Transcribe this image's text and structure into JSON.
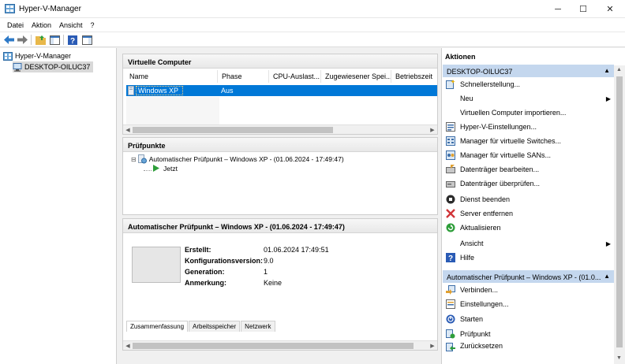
{
  "window": {
    "title": "Hyper-V-Manager",
    "controls": {
      "minimize": "─",
      "maximize": "☐",
      "close": "✕"
    }
  },
  "menu": [
    "Datei",
    "Aktion",
    "Ansicht",
    "?"
  ],
  "tree": {
    "root": "Hyper-V-Manager",
    "host": "DESKTOP-OILUC37"
  },
  "vm_panel": {
    "title": "Virtuelle Computer",
    "columns": [
      "Name",
      "Phase",
      "CPU-Auslast...",
      "Zugewiesener Spei...",
      "Betriebszeit"
    ],
    "rows": [
      {
        "name": "Windows XP",
        "phase": "Aus",
        "cpu": "",
        "mem": "",
        "uptime": ""
      }
    ]
  },
  "checkpoint_panel": {
    "title": "Prüfpunkte",
    "items": [
      "Automatischer Prüfpunkt – Windows XP - (01.06.2024 - 17:49:47)",
      "Jetzt"
    ]
  },
  "details_panel": {
    "title": "Automatischer Prüfpunkt – Windows XP - (01.06.2024 - 17:49:47)",
    "fields": [
      {
        "label": "Erstellt:",
        "value": "01.06.2024 17:49:51"
      },
      {
        "label": "Konfigurationsversion:",
        "value": "9.0"
      },
      {
        "label": "Generation:",
        "value": "1"
      },
      {
        "label": "Anmerkung:",
        "value": "Keine"
      }
    ],
    "tabs": [
      "Zusammenfassung",
      "Arbeitsspeicher",
      "Netzwerk"
    ]
  },
  "actions_panel": {
    "title": "Aktionen",
    "section1": {
      "header": "DESKTOP-OILUC37",
      "items": [
        {
          "label": "Schnellerstellung...",
          "icon": "quick-create-icon"
        },
        {
          "label": "Neu",
          "icon": "",
          "submenu": "▶"
        },
        {
          "label": "Virtuellen Computer importieren...",
          "icon": "import-icon"
        },
        {
          "label": "Hyper-V-Einstellungen...",
          "icon": "settings-icon"
        },
        {
          "label": "Manager für virtuelle Switches...",
          "icon": "switch-icon"
        },
        {
          "label": "Manager für virtuelle SANs...",
          "icon": "san-icon"
        },
        {
          "label": "Datenträger bearbeiten...",
          "icon": "edit-disk-icon"
        },
        {
          "label": "Datenträger überprüfen...",
          "icon": "inspect-disk-icon"
        },
        {
          "label": "Dienst beenden",
          "icon": "stop-service-icon"
        },
        {
          "label": "Server entfernen",
          "icon": "remove-server-icon"
        },
        {
          "label": "Aktualisieren",
          "icon": "refresh-icon"
        },
        {
          "label": "Ansicht",
          "icon": "",
          "submenu": "▶"
        },
        {
          "label": "Hilfe",
          "icon": "help-icon"
        }
      ]
    },
    "section2": {
      "header": "Automatischer Prüfpunkt – Windows XP - (01.0...",
      "items": [
        {
          "label": "Verbinden...",
          "icon": "connect-icon"
        },
        {
          "label": "Einstellungen...",
          "icon": "vm-settings-icon"
        },
        {
          "label": "Starten",
          "icon": "start-icon"
        },
        {
          "label": "Prüfpunkt",
          "icon": "checkpoint-icon"
        },
        {
          "label": "Zurücksetzen",
          "icon": "revert-icon"
        }
      ]
    }
  },
  "colors": {
    "selection": "#0078d7",
    "section_header": "#c4d7ee",
    "start_green": "#2e9e3a"
  }
}
